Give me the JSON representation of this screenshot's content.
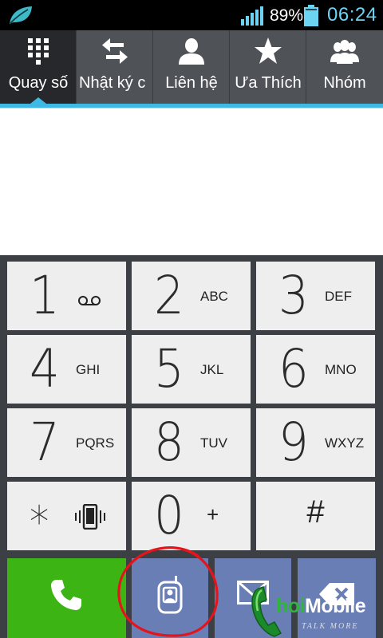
{
  "status_bar": {
    "app_icon": "leaf-icon",
    "signal_icon": "signal-bars-icon",
    "battery_percent": "89%",
    "battery_icon": "battery-icon",
    "time": "06:24",
    "time_color": "#6cd3f2"
  },
  "tabs": [
    {
      "label": "Quay số",
      "icon": "dialpad-icon",
      "active": true
    },
    {
      "label": "Nhật ký c",
      "icon": "swap-arrows-icon",
      "active": false
    },
    {
      "label": "Liên hệ",
      "icon": "person-icon",
      "active": false
    },
    {
      "label": "Ưa Thích",
      "icon": "star-icon",
      "active": false
    },
    {
      "label": "Nhóm",
      "icon": "group-icon",
      "active": false
    }
  ],
  "accent_color": "#3db9e3",
  "keypad": {
    "keys": [
      {
        "digit": "1",
        "letters": "",
        "icon": "voicemail-icon"
      },
      {
        "digit": "2",
        "letters": "ABC"
      },
      {
        "digit": "3",
        "letters": "DEF"
      },
      {
        "digit": "4",
        "letters": "GHI"
      },
      {
        "digit": "5",
        "letters": "JKL"
      },
      {
        "digit": "6",
        "letters": "MNO"
      },
      {
        "digit": "7",
        "letters": "PQRS"
      },
      {
        "digit": "8",
        "letters": "TUV"
      },
      {
        "digit": "9",
        "letters": "WXYZ"
      },
      {
        "digit": "*",
        "letters": "",
        "icon": "vibrate-icon"
      },
      {
        "digit": "0",
        "letters": "+"
      },
      {
        "digit": "#",
        "letters": ""
      }
    ]
  },
  "actions": {
    "call_icon": "phone-icon",
    "call_color": "#3cb414",
    "video_call_icon": "video-call-icon",
    "message_icon": "envelope-icon",
    "backspace_icon": "backspace-icon"
  },
  "watermark": {
    "brand_green": "hoi",
    "brand_white": "Mobile",
    "tagline": "TALK MORE"
  }
}
